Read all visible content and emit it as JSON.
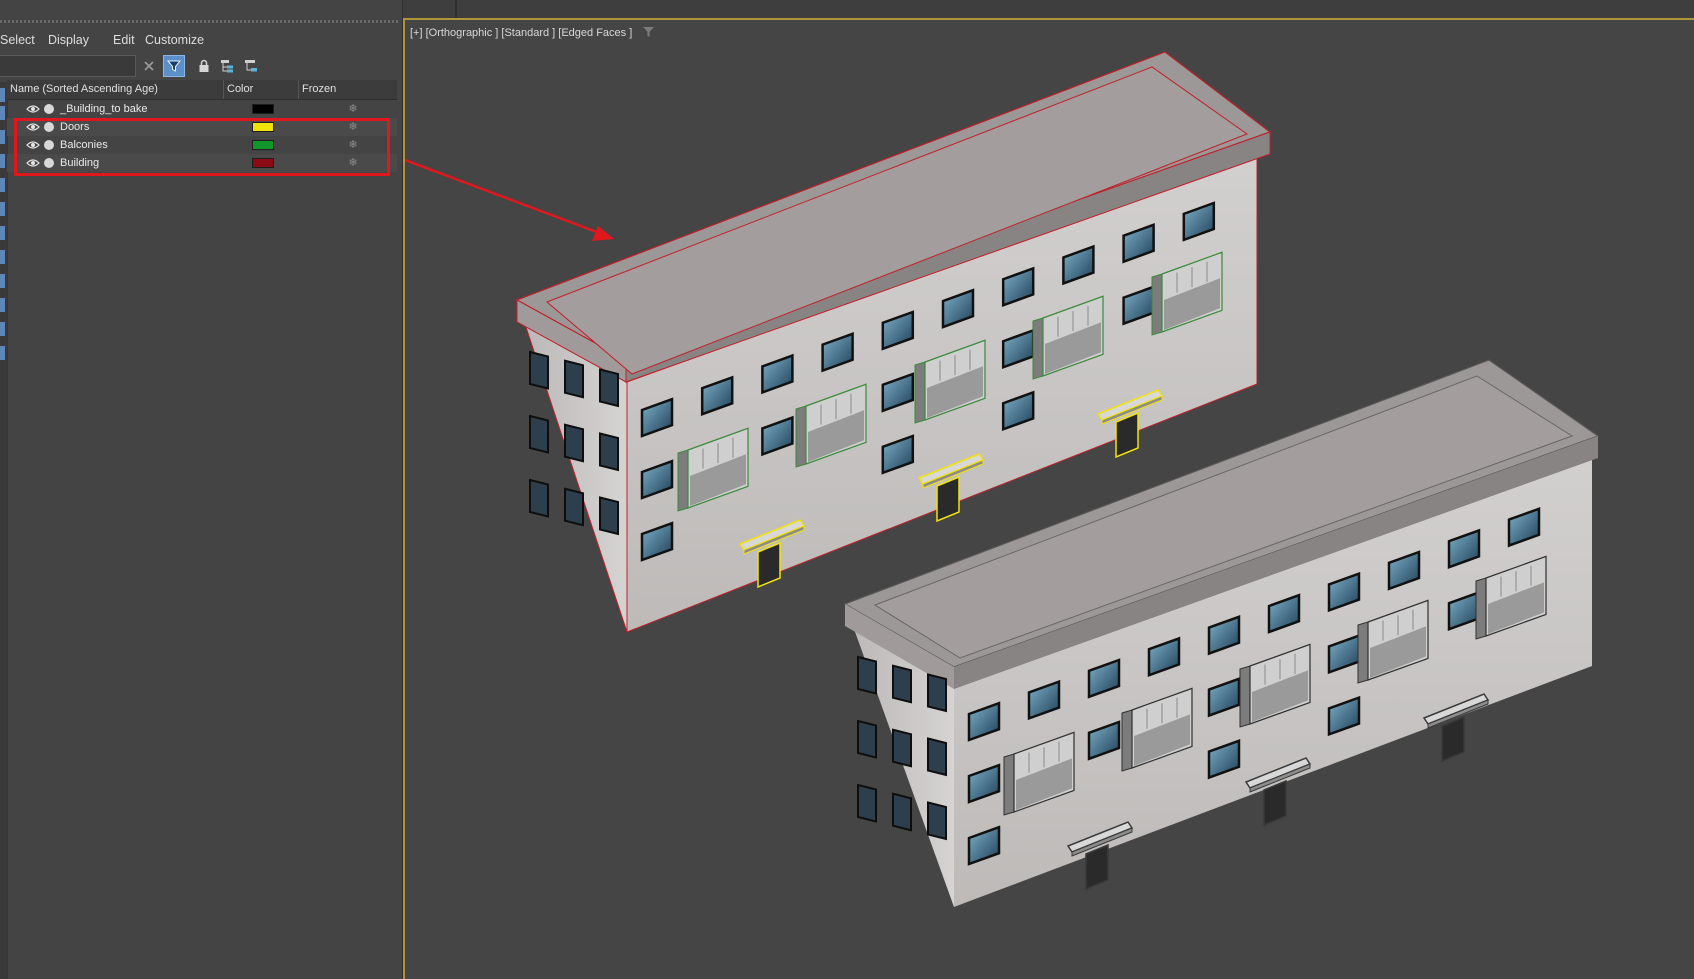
{
  "menu": {
    "select": "Select",
    "display": "Display",
    "edit": "Edit",
    "customize": "Customize"
  },
  "toolbar": {
    "search_value": "",
    "icons": [
      "clear-icon",
      "filter-icon",
      "lock-icon",
      "hierarchy-icon",
      "hierarchy-collapse-icon"
    ]
  },
  "columns": {
    "name": "Name (Sorted Ascending Age)",
    "color": "Color",
    "frozen": "Frozen"
  },
  "layers": [
    {
      "name": "_Building_to bake",
      "color": "#000000",
      "frozen_icon": "❄"
    },
    {
      "name": "Doors",
      "color": "#f2e20c",
      "frozen_icon": "❄"
    },
    {
      "name": "Balconies",
      "color": "#12952a",
      "frozen_icon": "❄"
    },
    {
      "name": "Building",
      "color": "#8c0a12",
      "frozen_icon": "❄"
    }
  ],
  "viewport": {
    "label": "[+] [Orthographic ] [Standard ] [Edged Faces ]",
    "filter_icon": "viewport-filter-icon"
  },
  "colors": {
    "highlight": "#e0181e",
    "selection_red": "#c0202a",
    "door_yellow": "#f2e20c",
    "balcony_green": "#3a8a3a",
    "active_border": "#b0953a"
  }
}
